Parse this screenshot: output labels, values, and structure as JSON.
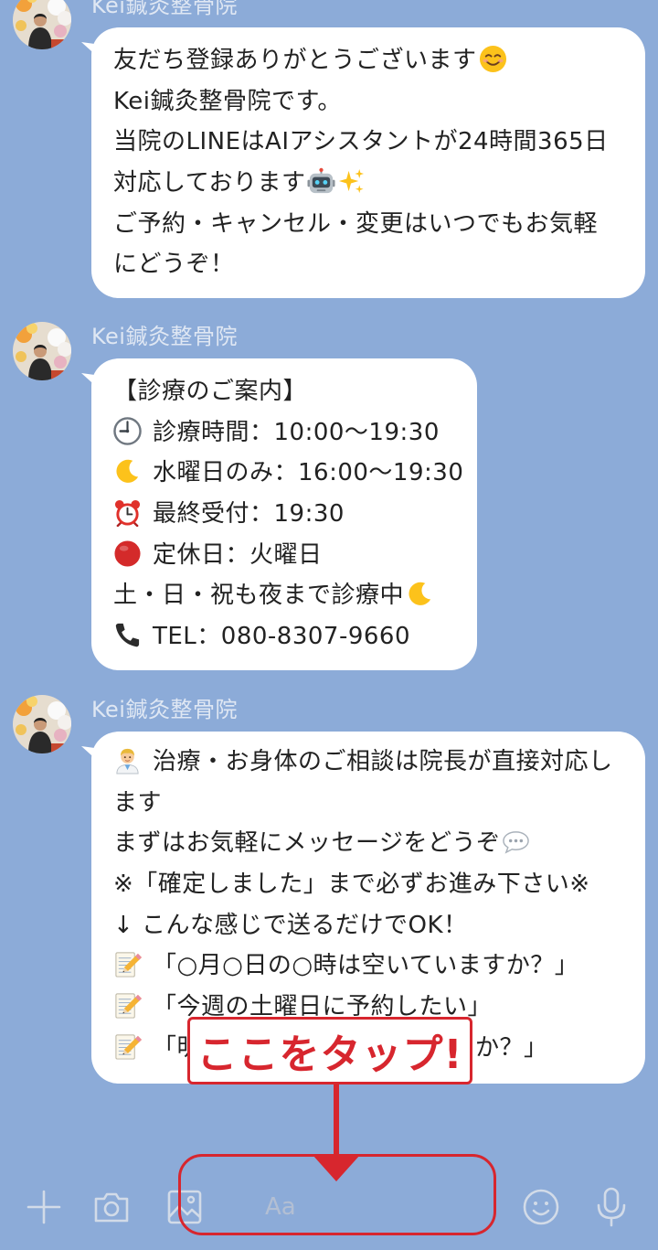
{
  "colors": {
    "chat_background": "#8cabd8",
    "bubble": "#ffffff",
    "message_text": "#222222",
    "sender_name": "#dfe7f3",
    "annotation_red": "#d7262e",
    "input_icons": "#d2dbe8"
  },
  "chat": {
    "messages": [
      {
        "sender": "Kei鍼灸整骨院",
        "lines": [
          {
            "text": "友だち登録ありがとうございます",
            "icons_after": [
              "smiling-face-icon"
            ]
          },
          {
            "text": "Kei鍼灸整骨院です。"
          },
          {
            "text": "当院のLINEはAIアシスタントが24時間365日"
          },
          {
            "text": "対応しております",
            "icons_after": [
              "robot-face-icon",
              "sparkles-icon"
            ]
          },
          {
            "text": "ご予約・キャンセル・変更はいつでもお気軽"
          },
          {
            "text": "にどうぞ！"
          }
        ]
      },
      {
        "sender": "Kei鍼灸整骨院",
        "lines": [
          {
            "text": "【診療のご案内】"
          },
          {
            "icon_before": "clock-nine-icon",
            "text": "診療時間：10:00〜19:30"
          },
          {
            "icon_before": "crescent-moon-icon",
            "text": "水曜日のみ：16:00〜19:30"
          },
          {
            "icon_before": "alarm-clock-icon",
            "text": "最終受付：19:30"
          },
          {
            "icon_before": "red-circle-icon",
            "text": "定休日：火曜日"
          },
          {
            "text": "土・日・祝も夜まで診療中",
            "icons_after": [
              "crescent-moon-icon"
            ]
          },
          {
            "icon_before": "telephone-icon",
            "text": "TEL：080-8307-9660"
          }
        ]
      },
      {
        "sender": "Kei鍼灸整骨院",
        "lines": [
          {
            "icon_before": "doctor-icon",
            "text": "治療・お身体のご相談は院長が直接対応し"
          },
          {
            "text": "ます"
          },
          {
            "text": "まずはお気軽にメッセージをどうぞ",
            "icons_after": [
              "speech-bubble-icon"
            ]
          },
          {
            "text": "※「確定しました」まで必ずお進み下さい※"
          },
          {
            "text": "↓ こんな感じで送るだけでOK！"
          },
          {
            "icon_before": "memo-icon",
            "text": "「○月○日の○時は空いていますか？」"
          },
          {
            "icon_before": "memo-icon",
            "text": "「今週の土曜日に予約したい」"
          },
          {
            "icon_before": "memo-icon",
            "text": "「明",
            "text_tail": "か？」"
          }
        ]
      }
    ]
  },
  "annotation": {
    "callout_text": "ここをタップ!"
  },
  "input_bar": {
    "placeholder": "Aa",
    "icons": [
      "plus-icon",
      "camera-icon",
      "image-icon",
      "emoji-icon",
      "microphone-icon"
    ]
  }
}
